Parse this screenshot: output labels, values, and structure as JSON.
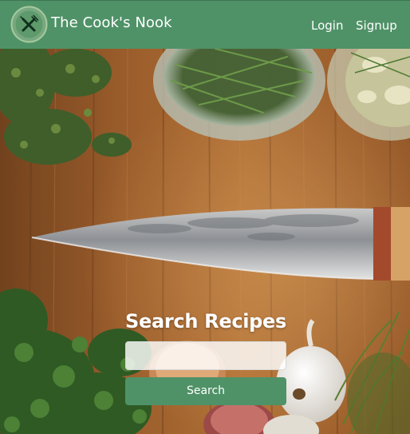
{
  "header": {
    "brand": "The Cook's Nook",
    "logo_icon": "fork-knife-icon",
    "nav": {
      "login": "Login",
      "signup": "Signup"
    }
  },
  "hero": {
    "background": "cutting-board-with-chef-knife-and-herbs",
    "search_title": "Search Recipes",
    "search_placeholder": "",
    "search_button": "Search"
  },
  "colors": {
    "brand_green": "#4f9267",
    "white": "#ffffff",
    "wood": "#b06a2f"
  }
}
